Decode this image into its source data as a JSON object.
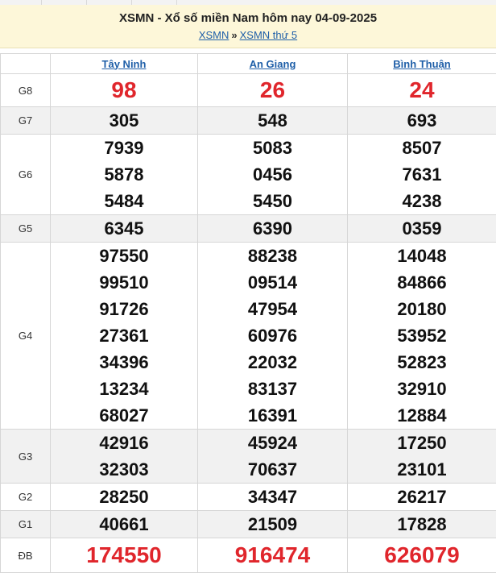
{
  "header": {
    "title": "XSMN - Xổ số miền Nam hôm nay 04-09-2025",
    "crumb_1": "XSMN",
    "separator": "»",
    "crumb_2": "XSMN thứ 5"
  },
  "provinces": [
    "Tây Ninh",
    "An Giang",
    "Bình Thuận"
  ],
  "prizes": [
    {
      "label": "G8",
      "values": [
        [
          "98"
        ],
        [
          "26"
        ],
        [
          "24"
        ]
      ]
    },
    {
      "label": "G7",
      "values": [
        [
          "305"
        ],
        [
          "548"
        ],
        [
          "693"
        ]
      ]
    },
    {
      "label": "G6",
      "values": [
        [
          "7939",
          "5878",
          "5484"
        ],
        [
          "5083",
          "0456",
          "5450"
        ],
        [
          "8507",
          "7631",
          "4238"
        ]
      ]
    },
    {
      "label": "G5",
      "values": [
        [
          "6345"
        ],
        [
          "6390"
        ],
        [
          "0359"
        ]
      ]
    },
    {
      "label": "G4",
      "values": [
        [
          "97550",
          "99510",
          "91726",
          "27361",
          "34396",
          "13234",
          "68027"
        ],
        [
          "88238",
          "09514",
          "47954",
          "60976",
          "22032",
          "83137",
          "16391"
        ],
        [
          "14048",
          "84866",
          "20180",
          "53952",
          "52823",
          "32910",
          "12884"
        ]
      ]
    },
    {
      "label": "G3",
      "values": [
        [
          "42916",
          "32303"
        ],
        [
          "45924",
          "70637"
        ],
        [
          "17250",
          "23101"
        ]
      ]
    },
    {
      "label": "G2",
      "values": [
        [
          "28250"
        ],
        [
          "34347"
        ],
        [
          "26217"
        ]
      ]
    },
    {
      "label": "G1",
      "values": [
        [
          "40661"
        ],
        [
          "21509"
        ],
        [
          "17828"
        ]
      ]
    },
    {
      "label": "ĐB",
      "values": [
        [
          "174550"
        ],
        [
          "916474"
        ],
        [
          "626079"
        ]
      ]
    }
  ],
  "colors": {
    "accent_red": "#e0262c",
    "link_blue": "#1f5fa8",
    "header_bg": "#fdf7d9",
    "alt_row_bg": "#f1f1f1"
  }
}
